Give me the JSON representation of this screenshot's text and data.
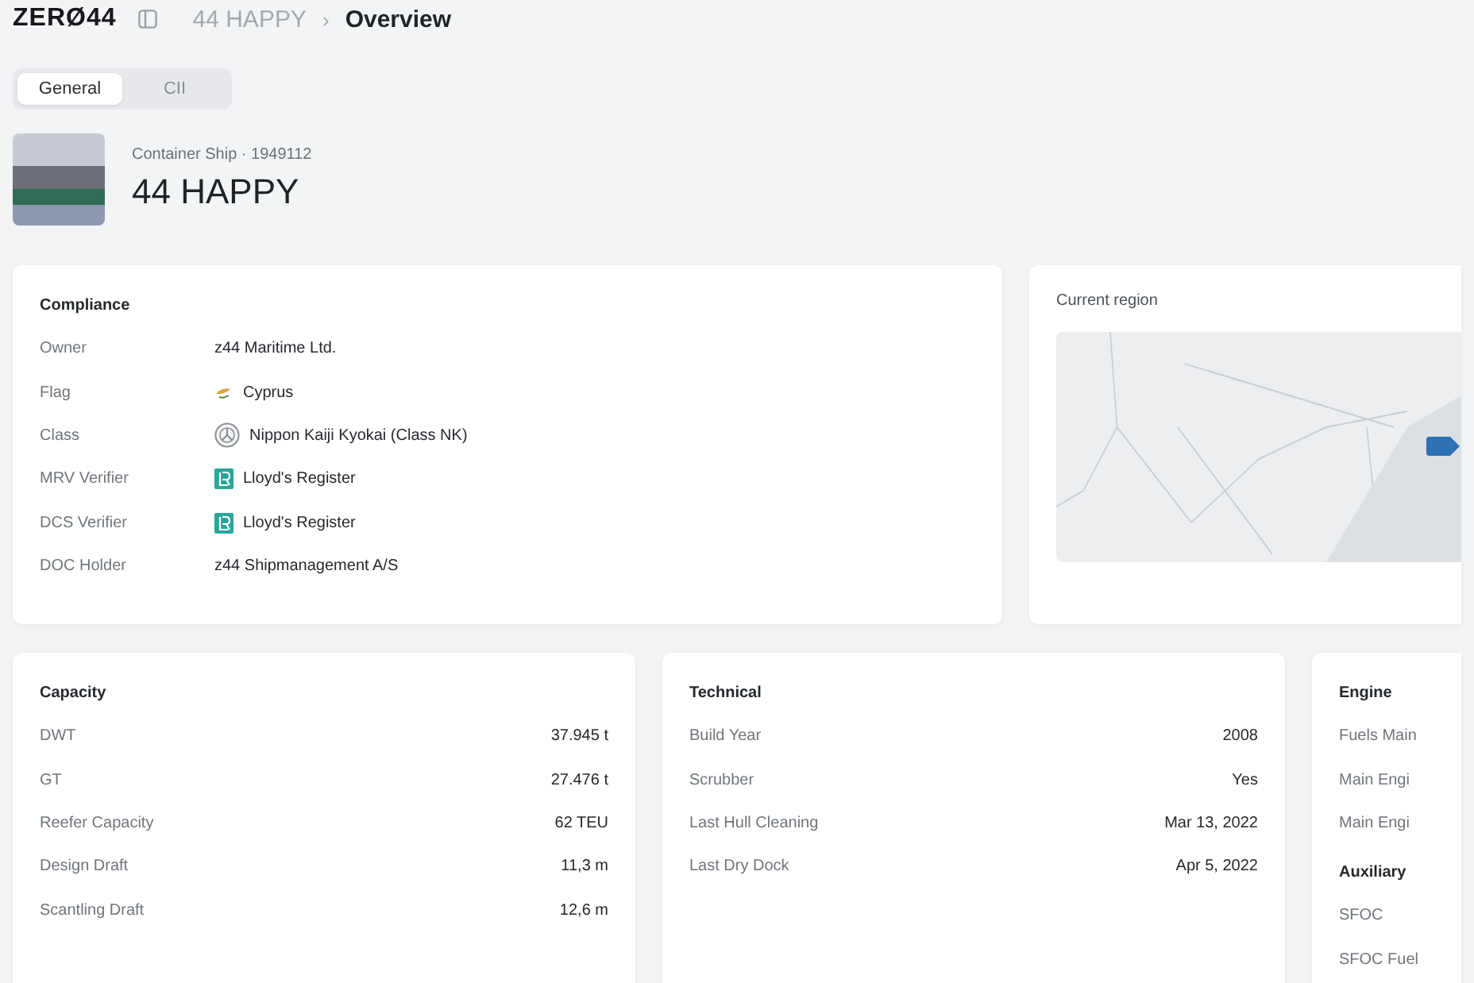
{
  "topbar": {
    "logo": "ZERØ44",
    "breadcrumb": [
      "44 HAPPY",
      "Overview"
    ],
    "separator": "›"
  },
  "tabs": [
    {
      "label": "General",
      "selected": true
    },
    {
      "label": "CII",
      "selected": false
    }
  ],
  "vessel": {
    "subtitle": "Container Ship · 1949112",
    "name": "44 HAPPY"
  },
  "compliance": {
    "title": "Compliance",
    "rows": [
      {
        "label": "Owner",
        "value": "z44 Maritime Ltd.",
        "kind": "plain"
      },
      {
        "label": "Flag",
        "value": "Cyprus",
        "kind": "flag"
      },
      {
        "label": "Class",
        "value": "Nippon Kaiji Kyokai (Class NK)",
        "kind": "emblem"
      },
      {
        "label": "MRV Verifier",
        "value": "Lloyd's Register",
        "kind": "logo"
      },
      {
        "label": "DCS Verifier",
        "value": "Lloyd's Register",
        "kind": "logo"
      },
      {
        "label": "DOC Holder",
        "value": "z44 Shipmanagement A/S",
        "kind": "plain"
      }
    ]
  },
  "region": {
    "title": "Current region"
  },
  "capacity": {
    "title": "Capacity",
    "rows": [
      {
        "label": "DWT",
        "value": "37.945 t"
      },
      {
        "label": "GT",
        "value": "27.476 t"
      },
      {
        "label": "Reefer Capacity",
        "value": "62 TEU"
      },
      {
        "label": "Design Draft",
        "value": "11,3 m"
      },
      {
        "label": "Scantling Draft",
        "value": "12,6 m"
      }
    ]
  },
  "technical": {
    "title": "Technical",
    "rows": [
      {
        "label": "Build Year",
        "value": "2008"
      },
      {
        "label": "Scrubber",
        "value": "Yes"
      },
      {
        "label": "Last Hull Cleaning",
        "value": "Mar 13, 2022"
      },
      {
        "label": "Last Dry Dock",
        "value": "Apr 5, 2022"
      }
    ]
  },
  "engine": {
    "title": "Engine",
    "rows": [
      {
        "label": "Fuels Main"
      },
      {
        "label": "Main Engi"
      },
      {
        "label": "Main Engi"
      }
    ],
    "subsection": {
      "title": "Auxiliary",
      "rows": [
        {
          "label": "SFOC"
        },
        {
          "label": "SFOC Fuel"
        }
      ]
    }
  }
}
